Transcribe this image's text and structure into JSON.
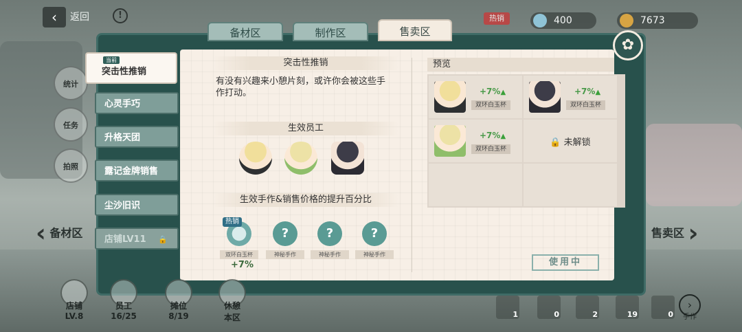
{
  "topbar": {
    "back_label": "返回",
    "hot_label": "热销",
    "currency1": "400",
    "currency2": "7673"
  },
  "tabs": [
    {
      "label": "备材区"
    },
    {
      "label": "制作区"
    },
    {
      "label": "售卖区"
    }
  ],
  "left_nav": [
    {
      "label": "统计"
    },
    {
      "label": "任务"
    },
    {
      "label": "拍照"
    }
  ],
  "sidebar": {
    "active": {
      "badge": "当前",
      "label": "突击性推销"
    },
    "items": [
      {
        "label": "心灵手巧"
      },
      {
        "label": "升格天团"
      },
      {
        "label": "露记金牌销售"
      },
      {
        "label": "尘沙旧识"
      },
      {
        "label": "店铺LV11"
      }
    ]
  },
  "content": {
    "title": "突击性推销",
    "description": "有没有兴趣来小憩片刻，或许你会被这些手作打动。",
    "staff_title": "生效员工",
    "crafts_title": "生效手作&销售价格的提升百分比",
    "hot_tag": "热销",
    "crafts": [
      {
        "name": "双环白玉杯",
        "icon": "cup-icon"
      },
      {
        "name": "神秘手作",
        "icon": "question-fan-icon"
      },
      {
        "name": "神秘手作",
        "icon": "question-fan-icon"
      },
      {
        "name": "神秘手作",
        "icon": "question-fan-icon"
      }
    ],
    "craft_bonus": "+7%"
  },
  "preview": {
    "title": "预览",
    "cells": [
      {
        "pct": "+7%",
        "name": "双环白玉杯"
      },
      {
        "pct": "+7%",
        "name": "双环白玉杯"
      },
      {
        "pct": "+7%",
        "name": "双环白玉杯"
      },
      {
        "locked": "未解锁"
      }
    ],
    "use_label": "使用中"
  },
  "side_nav": {
    "left": "备材区",
    "right": "售卖区"
  },
  "bottom": {
    "stats": [
      {
        "label": "店铺",
        "value": "LV.8"
      },
      {
        "label": "员工",
        "value": "16/25"
      },
      {
        "label": "摊位",
        "value": "8/19"
      },
      {
        "label": "休憩",
        "value": "本区"
      }
    ],
    "inventory": [
      {
        "count": "1"
      },
      {
        "count": "0"
      },
      {
        "count": "2"
      },
      {
        "count": "19"
      },
      {
        "count": "0"
      }
    ],
    "craft_label": "手作"
  },
  "colors": {
    "frame": "#28514c",
    "panel": "#f7efe6",
    "accent": "#2f5e58",
    "bonus": "#4a9a4a"
  }
}
